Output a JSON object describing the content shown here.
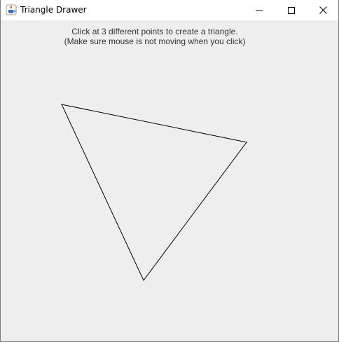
{
  "window": {
    "title": "Triangle Drawer",
    "app_icon": "java-cup-icon"
  },
  "controls": {
    "minimize_icon": "minimize-icon",
    "maximize_icon": "maximize-icon",
    "close_icon": "close-icon"
  },
  "canvas": {
    "instruction_line1": "Click at 3 different points to create a triangle.",
    "instruction_line2": "(Make sure mouse is not moving when you click)",
    "shape": "triangle",
    "stroke_color": "#000000",
    "background_color": "#eeeeee"
  }
}
